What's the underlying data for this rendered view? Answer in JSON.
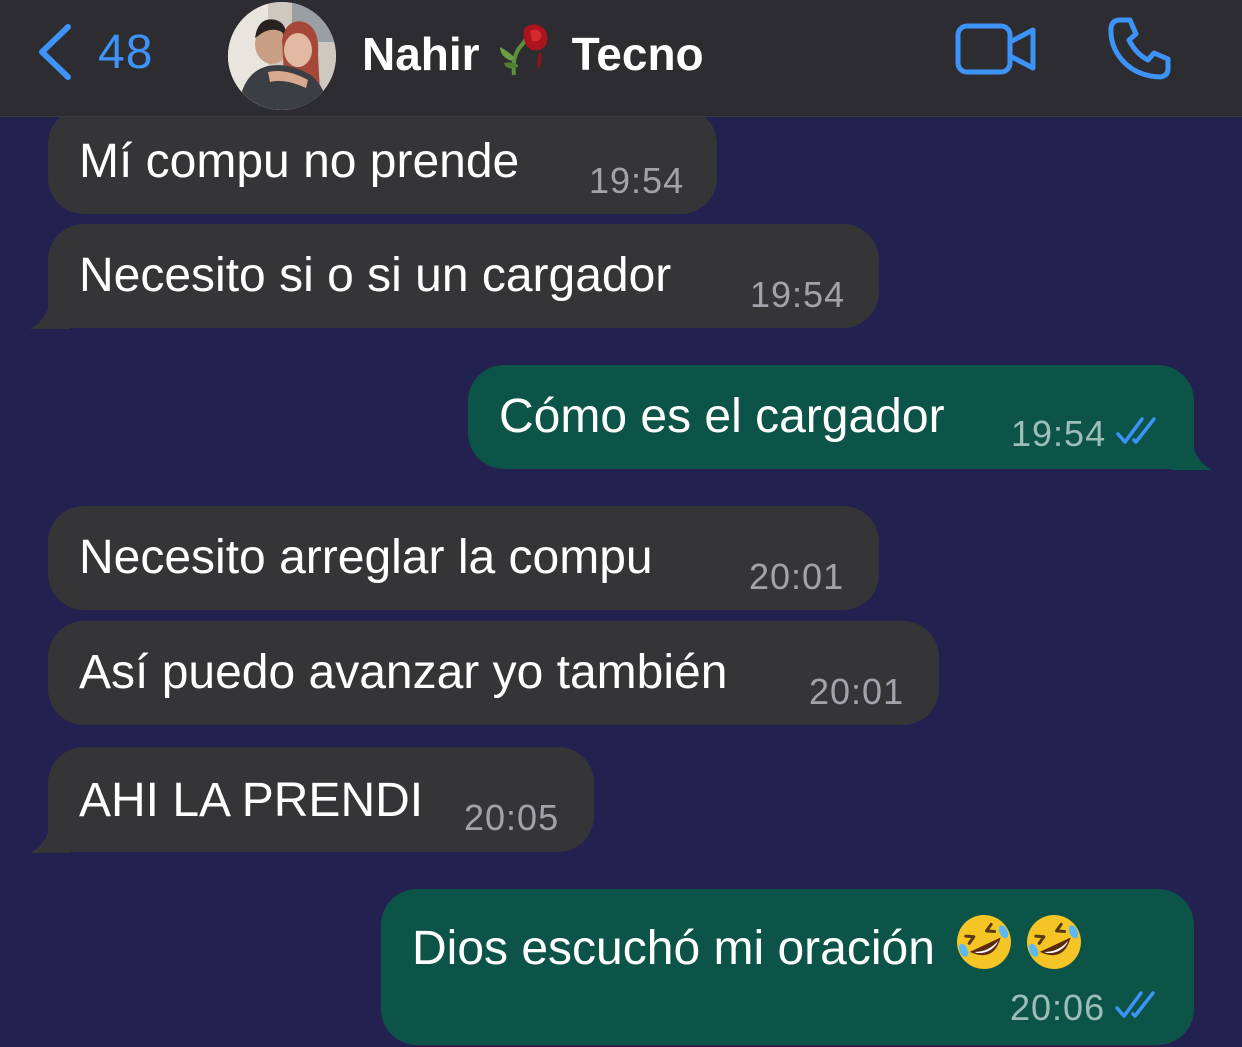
{
  "header": {
    "back_count": "48",
    "contact_name_first": "Nahir",
    "contact_name_last": "Tecno",
    "icons": {
      "back": "chevron-left-icon",
      "video": "video-camera-icon",
      "call": "phone-icon",
      "name_emoji": "wilted-rose-emoji"
    }
  },
  "colors": {
    "chat_background": "#232150",
    "header_background": "#2d2d31",
    "incoming_bubble": "#353538",
    "outgoing_bubble": "#0c5448",
    "accent_blue": "#3d93f7"
  },
  "messages": [
    {
      "direction": "in",
      "text": "Mí compu no prende",
      "time": "19:54"
    },
    {
      "direction": "in",
      "text": "Necesito si o si un cargador",
      "time": "19:54"
    },
    {
      "direction": "out",
      "text": "Cómo es el cargador",
      "time": "19:54",
      "status": "read"
    },
    {
      "direction": "in",
      "text": "Necesito arreglar la compu",
      "time": "20:01"
    },
    {
      "direction": "in",
      "text": "Así puedo avanzar yo también",
      "time": "20:01"
    },
    {
      "direction": "in",
      "text": "AHI LA PRENDI",
      "time": "20:05"
    },
    {
      "direction": "out",
      "text": "Dios escuchó mi oración",
      "emoji": [
        "rolling-on-floor-laughing",
        "rolling-on-floor-laughing"
      ],
      "time": "20:06",
      "status": "read"
    }
  ]
}
